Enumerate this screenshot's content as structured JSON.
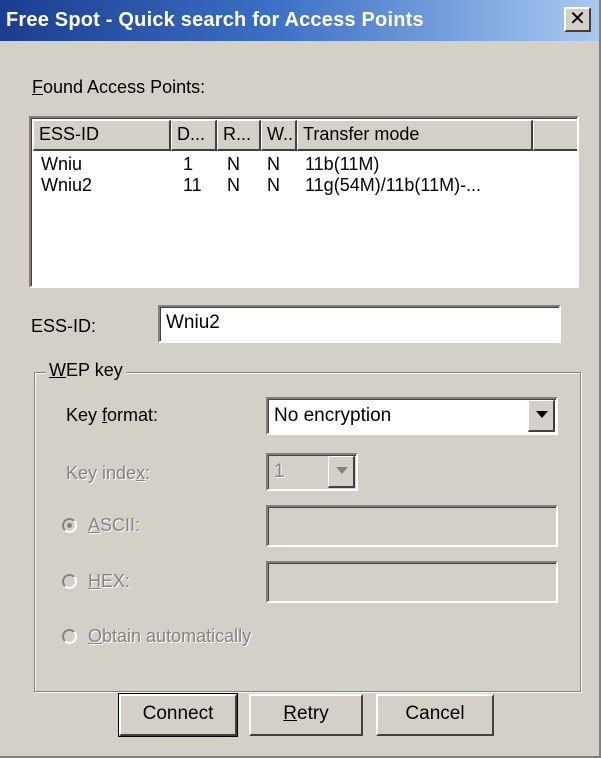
{
  "window": {
    "title": "Free Spot - Quick search for Access Points",
    "close_glyph": "✕"
  },
  "found_label": {
    "mnemonic": "F",
    "rest": "ound Access Points:"
  },
  "listview": {
    "columns": [
      "ESS-ID",
      "D...",
      "R...",
      "W..",
      "Transfer mode"
    ],
    "rows": [
      [
        "Wniu",
        "1",
        "N",
        "N",
        "11b(11M)"
      ],
      [
        "Wniu2",
        "11",
        "N",
        "N",
        "11g(54M)/11b(11M)-..."
      ]
    ]
  },
  "essid": {
    "label": "ESS-ID:",
    "value": "Wniu2"
  },
  "wep": {
    "group_title": {
      "mnemonic": "W",
      "rest": "EP key"
    },
    "key_format": {
      "pre": "Key ",
      "mnemonic": "f",
      "post": "ormat:",
      "value": "No encryption"
    },
    "key_index": {
      "pre": "Key inde",
      "mnemonic": "x",
      "post": ":",
      "value": "1"
    },
    "ascii": {
      "mnemonic": "A",
      "rest": "SCII:",
      "value": ""
    },
    "hex": {
      "mnemonic": "H",
      "rest": "EX:",
      "value": ""
    },
    "obtain": {
      "mnemonic": "O",
      "rest": "btain automatically"
    }
  },
  "buttons": {
    "connect": "Connect",
    "retry": {
      "mnemonic": "R",
      "rest": "etry"
    },
    "cancel": "Cancel"
  }
}
